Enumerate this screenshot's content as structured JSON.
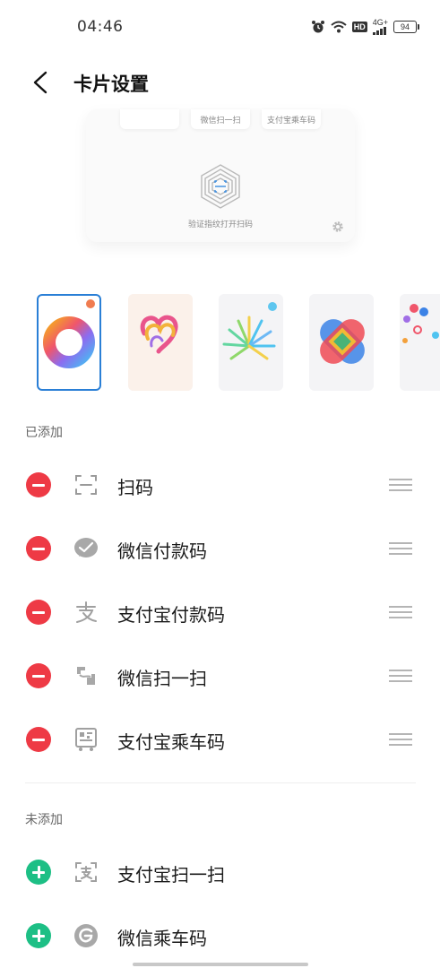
{
  "status_bar": {
    "time": "04:46",
    "network": "4G+",
    "hd": "HD",
    "battery": "94"
  },
  "header": {
    "title": "卡片设置"
  },
  "preview": {
    "chip_wechat_scan": "微信扫一扫",
    "chip_alipay_transit": "支付宝乘车码",
    "caption": "验证指纹打开扫码"
  },
  "sections": {
    "added_label": "已添加",
    "not_added_label": "未添加"
  },
  "added_items": [
    {
      "label": "扫码",
      "icon": "scan-icon"
    },
    {
      "label": "微信付款码",
      "icon": "wechat-icon"
    },
    {
      "label": "支付宝付款码",
      "icon": "alipay-icon"
    },
    {
      "label": "微信扫一扫",
      "icon": "wechat-scan-icon"
    },
    {
      "label": "支付宝乘车码",
      "icon": "transit-code-icon"
    }
  ],
  "not_added_items": [
    {
      "label": "支付宝扫一扫",
      "icon": "alipay-scan-icon"
    },
    {
      "label": "微信乘车码",
      "icon": "wechat-transit-icon"
    }
  ],
  "themes": [
    {
      "name": "ring-theme",
      "selected": true
    },
    {
      "name": "heart-ribbon-theme",
      "selected": false
    },
    {
      "name": "burst-theme",
      "selected": false
    },
    {
      "name": "cross-tiles-theme",
      "selected": false
    },
    {
      "name": "dots-theme",
      "selected": false
    }
  ],
  "colors": {
    "remove": "#ee3a45",
    "add": "#1dbf85",
    "selected_border": "#2a7fd6"
  }
}
